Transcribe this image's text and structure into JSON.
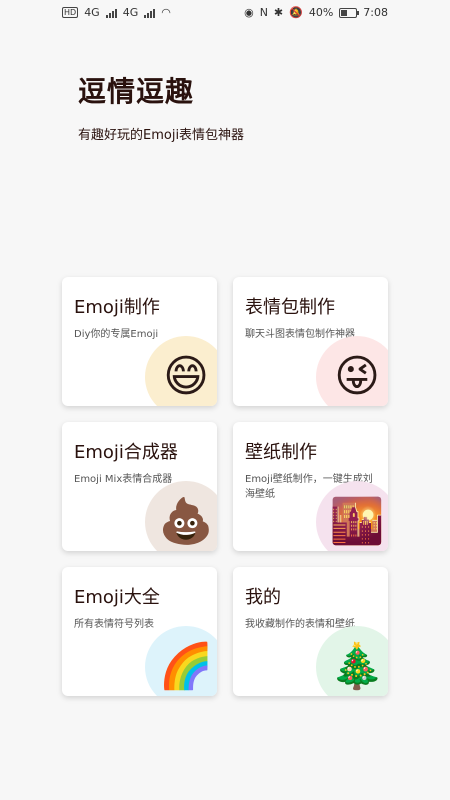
{
  "status": {
    "time": "7:08",
    "battery": "40%",
    "battery_level": 0.4,
    "network_left": "4G",
    "network_right": "4G"
  },
  "header": {
    "title": "逗情逗趣",
    "subtitle": "有趣好玩的Emoji表情包神器"
  },
  "cards": [
    {
      "title": "Emoji制作",
      "desc": "Diy你的专属Emoji",
      "icon": "grinning-face-icon",
      "glyph": "😄",
      "bg": "#fbeecf"
    },
    {
      "title": "表情包制作",
      "desc": "聊天斗图表情包制作神器",
      "icon": "kissing-tongue-face-icon",
      "glyph": "😜",
      "bg": "#fde6e6"
    },
    {
      "title": "Emoji合成器",
      "desc": "Emoji Mix表情合成器",
      "icon": "poop-icon",
      "glyph": "💩",
      "bg": "#efe6e0"
    },
    {
      "title": "壁纸制作",
      "desc": "Emoji壁纸制作，一键生成刘海壁纸",
      "icon": "city-skyline-icon",
      "glyph": "🌇",
      "bg": "#f5e2ee"
    },
    {
      "title": "Emoji大全",
      "desc": "所有表情符号列表",
      "icon": "rainbow-face-icon",
      "glyph": "🌈",
      "bg": "#ddf3fb"
    },
    {
      "title": "我的",
      "desc": "我收藏制作的表情和壁纸",
      "icon": "christmas-tree-icon",
      "glyph": "🎄",
      "bg": "#e2f5e8"
    }
  ]
}
